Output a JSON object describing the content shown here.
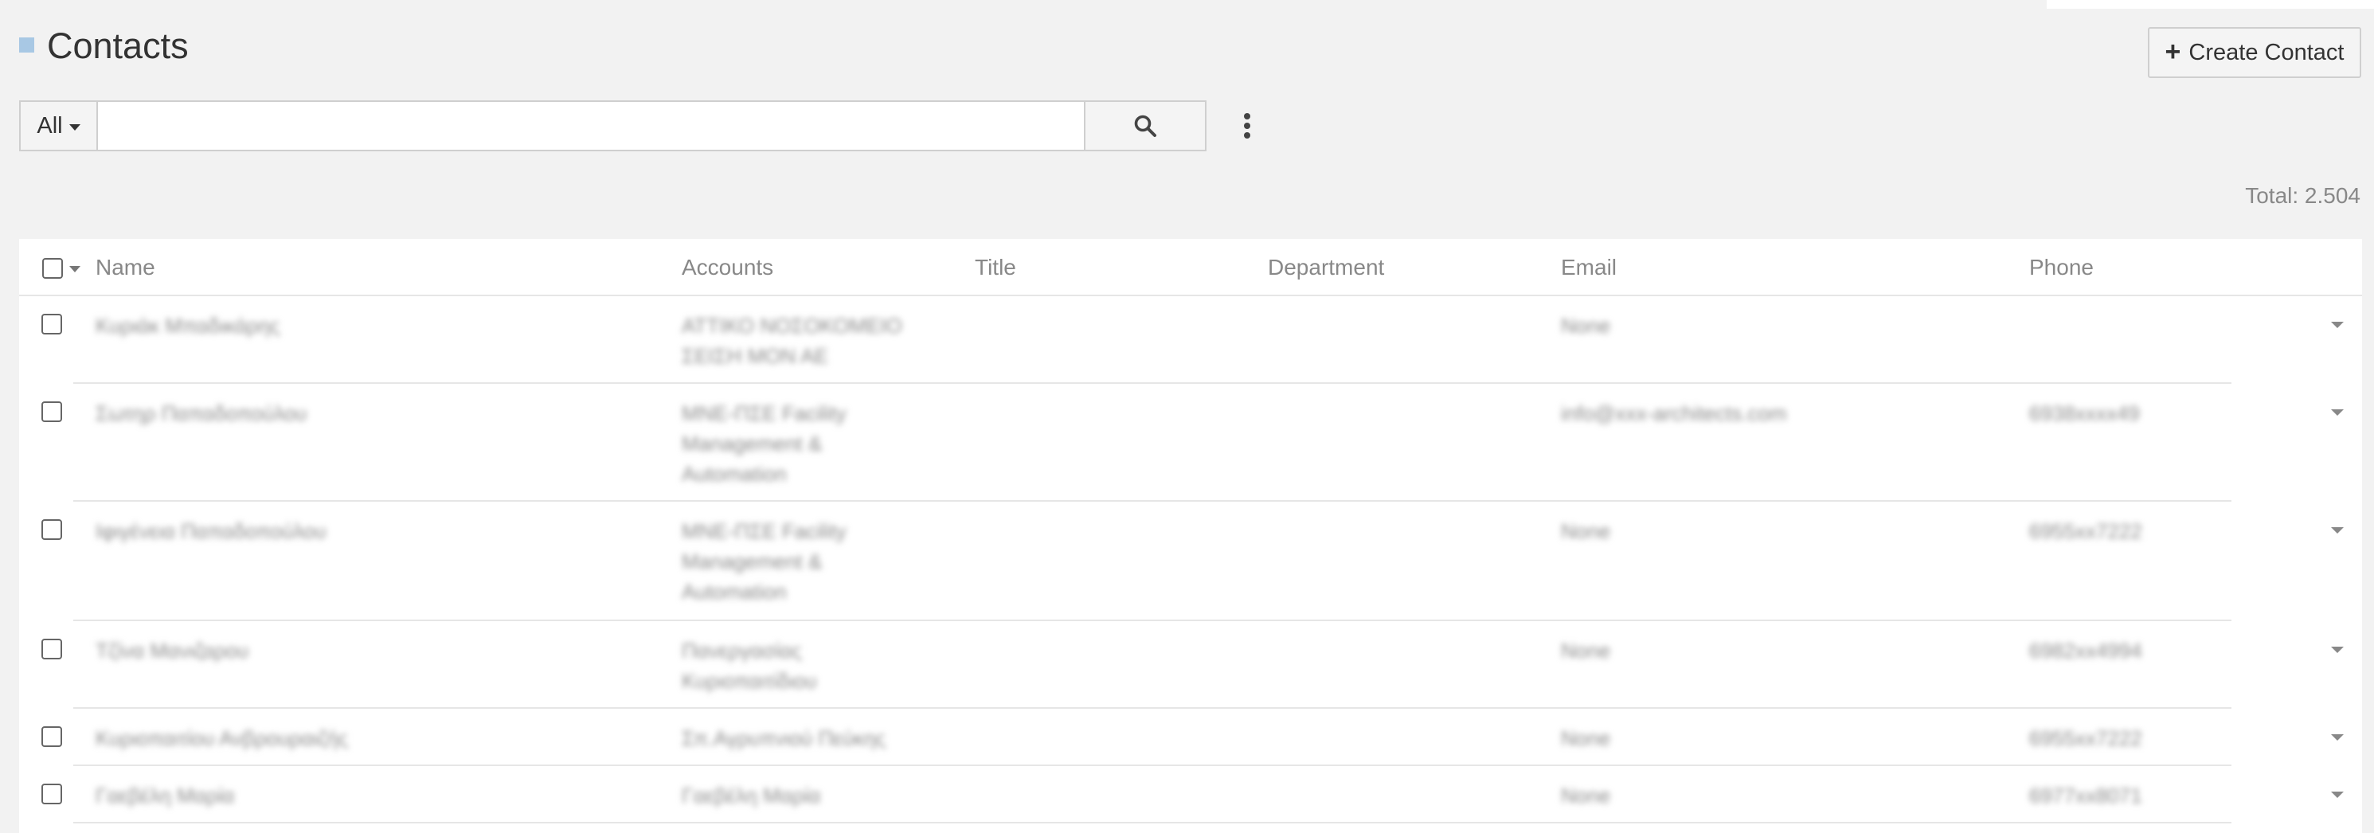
{
  "header": {
    "title": "Contacts",
    "create_label": "Create Contact"
  },
  "search": {
    "filter_label": "All",
    "placeholder": "",
    "value": ""
  },
  "total_label": "Total: 2.504",
  "table": {
    "columns": [
      "Name",
      "Accounts",
      "Title",
      "Department",
      "Email",
      "Phone"
    ],
    "rows": [
      {
        "name": "Κυριάκ Μπαδικάρης",
        "accounts": "ΑΤΤΙΚΟ ΝΟΣΟΚΟΜΕΙΟ ΣΕΙΣΗ ΜΟΝ ΑΕ",
        "title": "",
        "department": "",
        "email": "None",
        "phone": ""
      },
      {
        "name": "Σωτηρ Παπαδοπούλου",
        "accounts": "ΜΝΕ-ΠΣΕ Facility Management & Automation",
        "title": "",
        "department": "",
        "email": "info@xxx-architects.com",
        "phone": "6938xxxx49"
      },
      {
        "name": "Ιφιγένεια Παπαδοπούλου",
        "accounts": "ΜΝΕ-ΠΣΕ Facility Management & Automation",
        "title": "",
        "department": "",
        "email": "None",
        "phone": "6955xx7222"
      },
      {
        "name": "Τζίνα Μανιζαρου",
        "accounts": "Πανεργασίας Κυριοπαιτίδιου",
        "title": "",
        "department": "",
        "email": "None",
        "phone": "6982xx4994"
      },
      {
        "name": "Κυριοπαιτίου Ανβρουραιζής",
        "accounts": "Σπ.Αγρυπνιού Πεύκης",
        "title": "",
        "department": "",
        "email": "None",
        "phone": "6955xx7222"
      },
      {
        "name": "Γαεβέλη Μαρία",
        "accounts": "Γαεβέλη Μαρία",
        "title": "",
        "department": "",
        "email": "None",
        "phone": "6977xx8071"
      }
    ]
  }
}
